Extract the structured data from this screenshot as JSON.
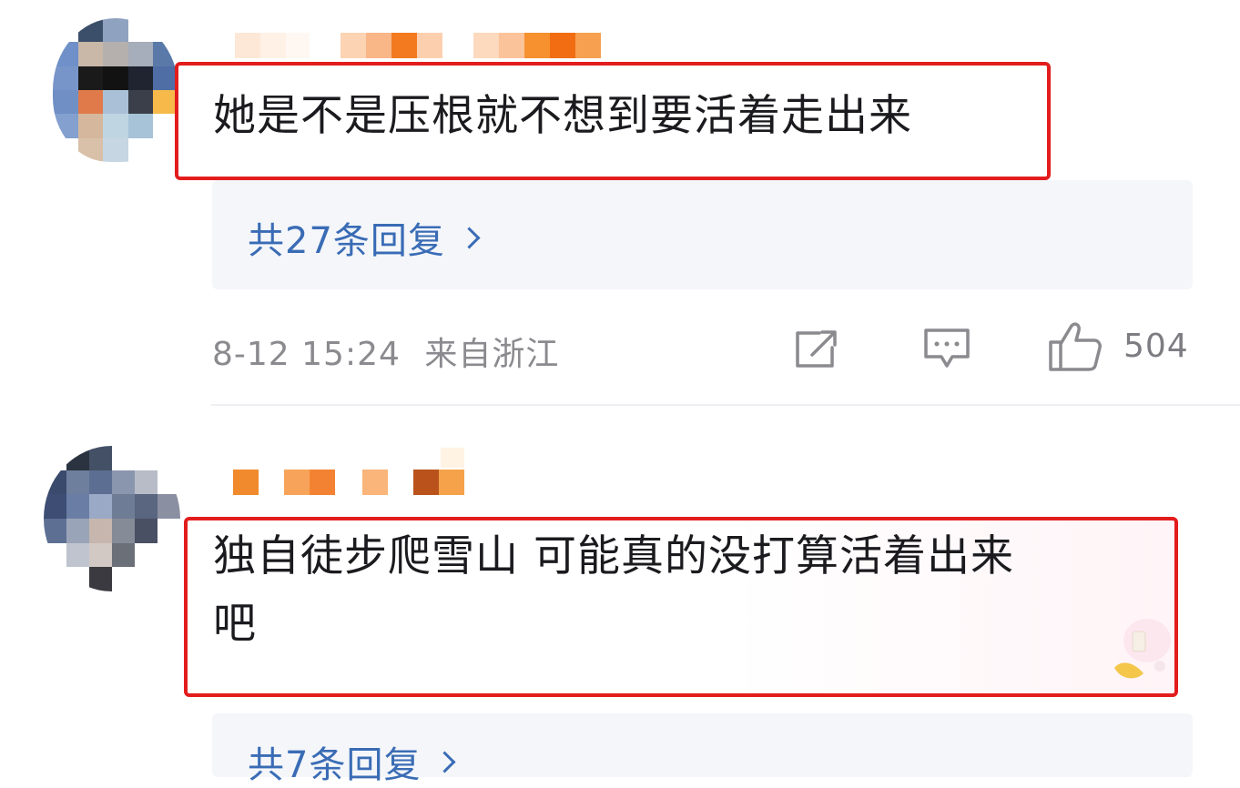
{
  "comments": [
    {
      "text": "她是不是压根就不想到要活着走出来",
      "replies_label": "共27条回复",
      "date": "8-12 15:24",
      "location": "来自浙江",
      "likes": "504"
    },
    {
      "text_line1": "独自徒步爬雪山 可能真的没打算活着出来",
      "text_line2": "吧",
      "replies_label": "共7条回复"
    }
  ],
  "icons": {
    "share": "share-icon",
    "comment": "comment-icon",
    "like": "thumbs-up-icon",
    "chevron": "chevron-right-icon"
  },
  "colors": {
    "highlight_box": "#e31c1c",
    "link": "#3a6cb5",
    "meta": "#8a8a8f",
    "reply_bg": "#f4f6fa"
  }
}
